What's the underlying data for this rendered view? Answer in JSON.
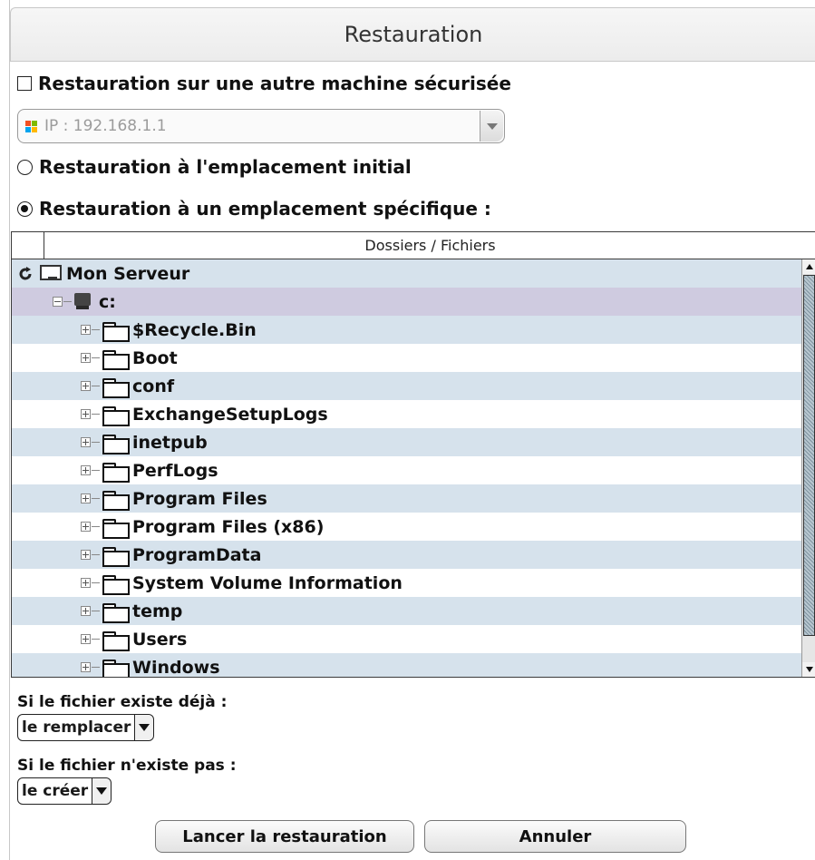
{
  "dialog": {
    "title": "Restauration"
  },
  "options": {
    "other_machine": {
      "label": "Restauration sur une autre machine sécurisée",
      "checked": false
    },
    "ip_select": {
      "value": "IP : 192.168.1.1",
      "icon": "windows-logo-icon"
    },
    "initial_location": {
      "label": "Restauration à l'emplacement initial",
      "selected": false
    },
    "specific_location": {
      "label": "Restauration à un emplacement spécifique :",
      "selected": true
    }
  },
  "tree": {
    "column_header": "Dossiers / Fichiers",
    "root": {
      "label": "Mon Serveur"
    },
    "drive": {
      "label": "c:"
    },
    "folders": [
      {
        "label": "$Recycle.Bin"
      },
      {
        "label": "Boot"
      },
      {
        "label": "conf"
      },
      {
        "label": "ExchangeSetupLogs"
      },
      {
        "label": "inetpub"
      },
      {
        "label": "PerfLogs"
      },
      {
        "label": "Program Files"
      },
      {
        "label": "Program Files (x86)"
      },
      {
        "label": "ProgramData"
      },
      {
        "label": "System Volume Information"
      },
      {
        "label": "temp"
      },
      {
        "label": "Users"
      },
      {
        "label": "Windows"
      }
    ]
  },
  "if_exists": {
    "label": "Si le fichier existe déjà :",
    "value": "le remplacer"
  },
  "if_not_exists": {
    "label": "Si le fichier n'existe pas :",
    "value": "le créer"
  },
  "buttons": {
    "start": "Lancer la restauration",
    "cancel": "Annuler"
  },
  "colors": {
    "row_alt": "#d6e2ec",
    "row_selected": "#cfcbe0",
    "win_red": "#f25022",
    "win_green": "#7fba00",
    "win_blue": "#00a4ef",
    "win_yellow": "#ffb900"
  }
}
